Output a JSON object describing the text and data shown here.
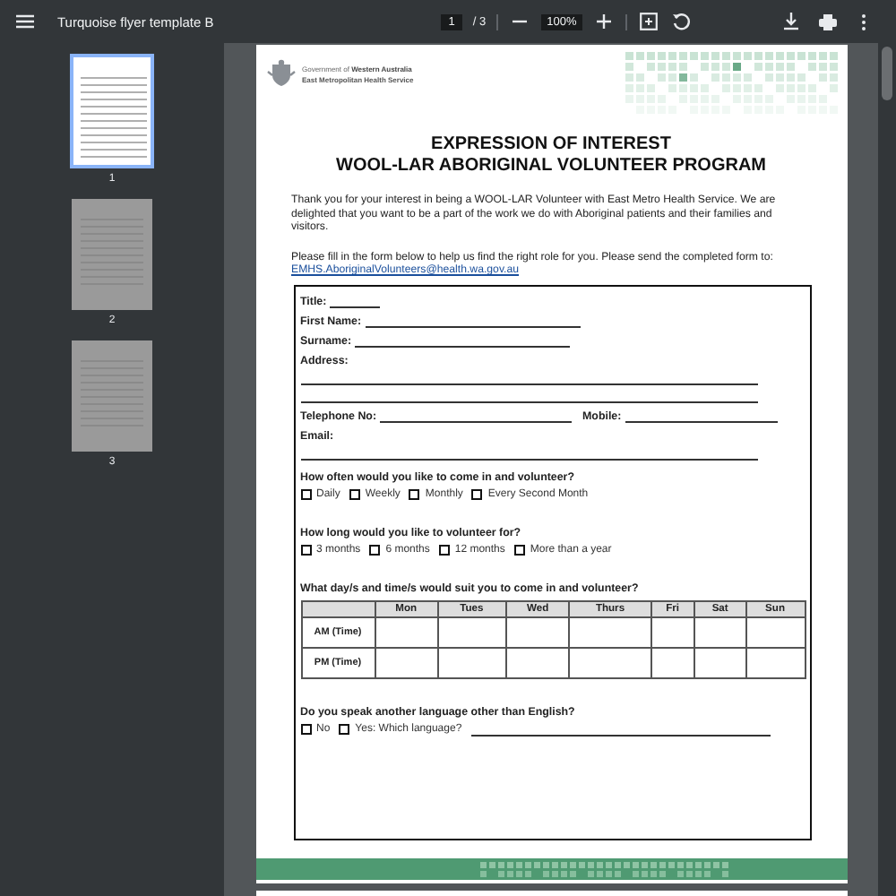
{
  "toolbar": {
    "title": "Turquoise flyer template B",
    "page_current": "1",
    "page_total": "/ 3",
    "zoom": "100%"
  },
  "thumbnails": [
    {
      "label": "1",
      "selected": true
    },
    {
      "label": "2",
      "selected": false
    },
    {
      "label": "3",
      "selected": false
    }
  ],
  "document": {
    "org": [
      "Government of **Western Australia**",
      "East Metropolitan Health Service"
    ],
    "heading": [
      "EXPRESSION OF INTEREST",
      "WOOL-LAR ABORIGINAL VOLUNTEER PROGRAM"
    ],
    "intro": "Thank you for your interest in being a WOOL-LAR Volunteer with East Metro Health Service.  We are delighted that you want to be a part of the work we do with Aboriginal patients and their families and visitors.",
    "instructions": "Please fill in the form below to help us find the right role for you.  Please send the completed form to:",
    "email_link": "EMHS.AboriginalVolunteers@health.wa.gov.au",
    "form": {
      "fields": [
        {
          "kind": "short",
          "label": "Title:"
        },
        {
          "kind": "field",
          "label": "First Name:"
        },
        {
          "kind": "field",
          "label": "Surname:"
        },
        {
          "kind": "address",
          "label": "Address:"
        },
        {
          "kind": "pair",
          "label": "Telephone No:",
          "label_2": "Mobile:"
        },
        {
          "kind": "email",
          "label": "Email:"
        }
      ],
      "questions": [
        {
          "text": "How often would you like to come in and volunteer?",
          "options": [
            {
              "label": "Daily",
              "checked": false
            },
            {
              "label": "Weekly",
              "checked": false
            },
            {
              "label": "Monthly",
              "checked": false
            },
            {
              "label": "Every Second Month",
              "checked": false
            }
          ]
        },
        {
          "text": "How long would you like to volunteer for?",
          "options": [
            {
              "label": "3 months",
              "checked": false
            },
            {
              "label": "6 months",
              "checked": false
            },
            {
              "label": "12 months",
              "checked": false
            },
            {
              "label": "More than a year",
              "checked": false
            }
          ]
        }
      ],
      "schedule": {
        "text": "What day/s and time/s would suit you to come in and volunteer?",
        "columns": [
          "Mon",
          "Tues",
          "Wed",
          "Thurs",
          "Fri",
          "Sat",
          "Sun"
        ],
        "rows": [
          "AM (Time)",
          "PM (Time)"
        ]
      },
      "language": {
        "text": "Do you speak another language other than English?",
        "options": [
          {
            "label": "No",
            "checked": false
          },
          {
            "label": "Yes: Which language?",
            "checked": false
          }
        ]
      }
    }
  }
}
